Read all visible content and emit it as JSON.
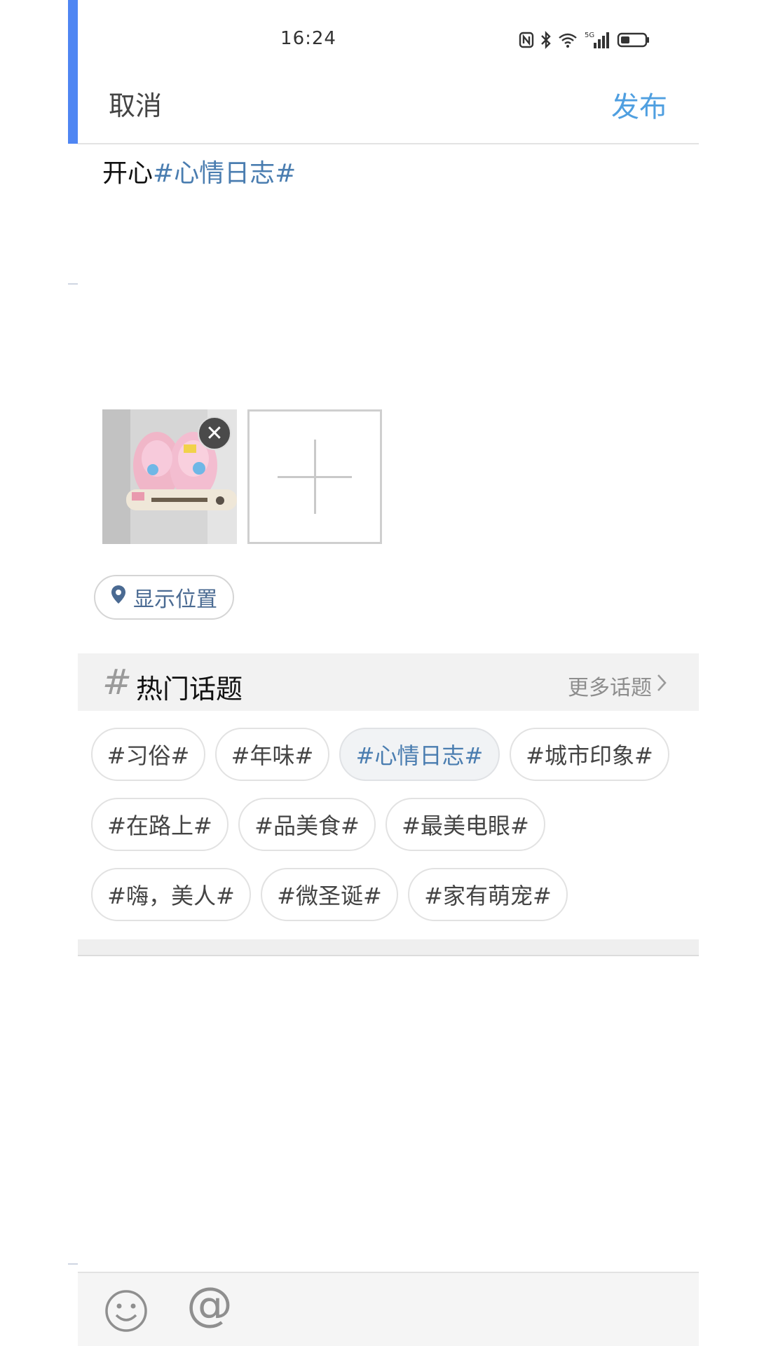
{
  "status_bar": {
    "time": "16:24",
    "icons": [
      "nfc-icon",
      "bluetooth-icon",
      "wifi-icon",
      "5g-signal-icon",
      "battery-icon"
    ],
    "network_label": "5G"
  },
  "header": {
    "cancel_label": "取消",
    "publish_label": "发布"
  },
  "post": {
    "text": "开心",
    "topic": "#心情日志#"
  },
  "photos": {
    "thumbnail_icon": "photo-thumbnail",
    "remove_icon": "close-icon",
    "remove_glyph": "✕",
    "add_icon": "plus-icon"
  },
  "location": {
    "icon": "location-pin-icon",
    "label": "显示位置"
  },
  "hot_topics": {
    "hash_symbol": "#",
    "title": "热门话题",
    "more_label": "更多话题",
    "more_icon": "chevron-right-icon",
    "tags": [
      {
        "label": "#习俗#",
        "active": false
      },
      {
        "label": "#年味#",
        "active": false
      },
      {
        "label": "#心情日志#",
        "active": true
      },
      {
        "label": "#城市印象#",
        "active": false
      },
      {
        "label": "#在路上#",
        "active": false
      },
      {
        "label": "#品美食#",
        "active": false
      },
      {
        "label": "#最美电眼#",
        "active": false
      },
      {
        "label": "#嗨，美人#",
        "active": false
      },
      {
        "label": "#微圣诞#",
        "active": false
      },
      {
        "label": "#家有萌宠#",
        "active": false
      }
    ]
  },
  "toolbar": {
    "emoji_icon": "smiley-icon",
    "mention_label": "@"
  },
  "colors": {
    "accent": "#4f9fe0",
    "topic_blue": "#4a7db0",
    "left_bar": "#4f86f3"
  }
}
